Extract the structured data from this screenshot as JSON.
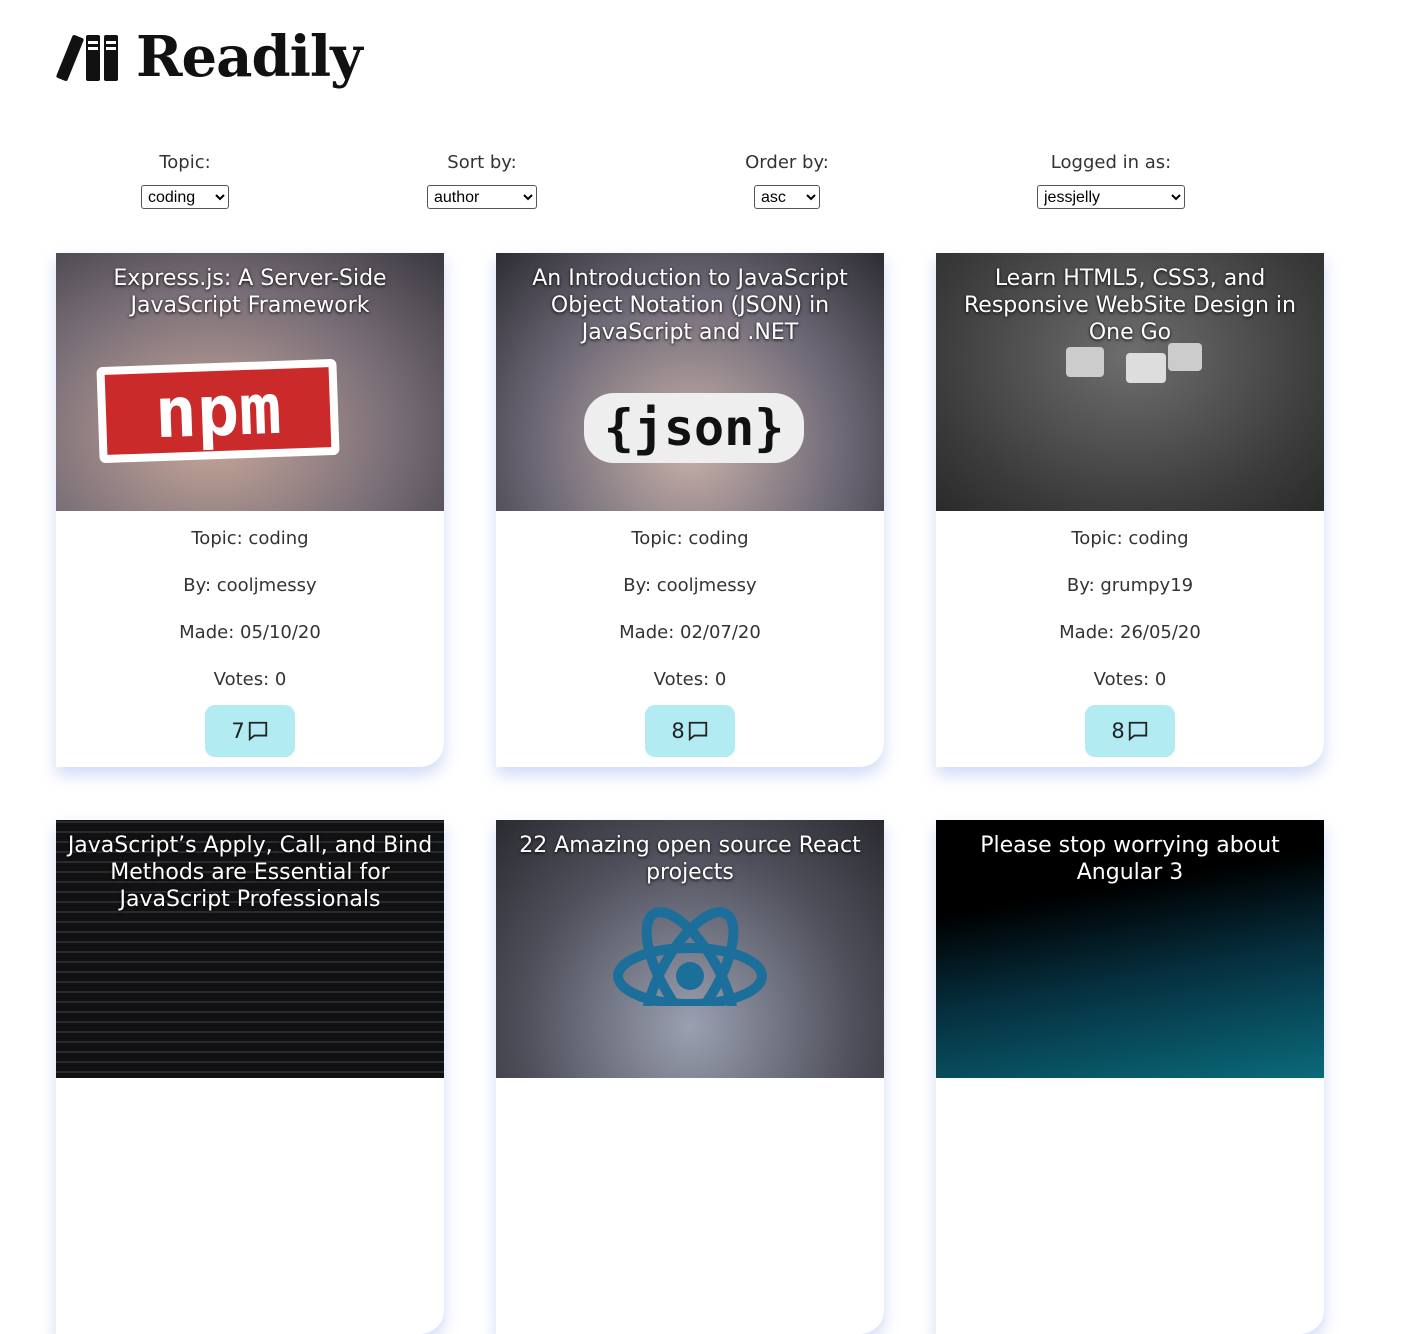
{
  "brand": {
    "name": "Readily"
  },
  "filters": [
    {
      "label": "Topic:",
      "value": "coding"
    },
    {
      "label": "Sort by:",
      "value": "author"
    },
    {
      "label": "Order by:",
      "value": "asc"
    },
    {
      "label": "Logged in as:",
      "value": "jessjelly"
    }
  ],
  "articles": [
    {
      "title": "Express.js: A Server-Side JavaScript Framework",
      "topic": "Topic: coding",
      "author": "By: cooljmessy",
      "made": "Made: 05/10/20",
      "votes": "Votes: 0",
      "comments": "7",
      "image_text": "npm"
    },
    {
      "title": "An Introduction to JavaScript Object Notation (JSON) in JavaScript and .NET",
      "topic": "Topic: coding",
      "author": "By: cooljmessy",
      "made": "Made: 02/07/20",
      "votes": "Votes: 0",
      "comments": "8",
      "image_text": "{json}"
    },
    {
      "title": "Learn HTML5, CSS3, and Responsive WebSite Design in One Go",
      "topic": "Topic: coding",
      "author": "By: grumpy19",
      "made": "Made: 26/05/20",
      "votes": "Votes: 0",
      "comments": "8"
    },
    {
      "title": "JavaScript’s Apply, Call, and Bind Methods are Essential for JavaScript Professionals"
    },
    {
      "title": "22 Amazing open source React projects"
    },
    {
      "title": "Please stop worrying about Angular 3"
    }
  ]
}
